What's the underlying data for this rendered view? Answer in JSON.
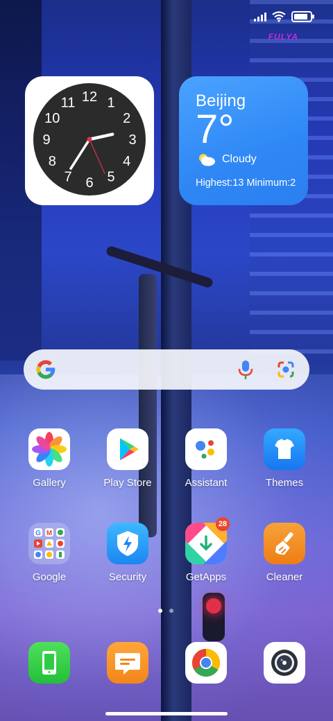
{
  "status_bar": {
    "signal": "signal-icon",
    "wifi": "wifi-icon",
    "battery_level": 0.85,
    "watermark": "FULYA"
  },
  "clock": {
    "numbers": [
      "12",
      "1",
      "2",
      "3",
      "4",
      "5",
      "6",
      "7",
      "8",
      "9",
      "10",
      "11"
    ],
    "hour": 2,
    "minute": 35,
    "second": 26
  },
  "weather": {
    "city": "Beijing",
    "temperature": "7°",
    "condition": "Cloudy",
    "high_low": "Highest:13 Minimum:2"
  },
  "search": {
    "google_icon": "google-g-icon",
    "mic_icon": "mic-icon",
    "lens_icon": "lens-icon"
  },
  "apps": [
    {
      "label": "Gallery",
      "icon": "gallery-icon"
    },
    {
      "label": "Play Store",
      "icon": "play-store-icon"
    },
    {
      "label": "Assistant",
      "icon": "assistant-icon"
    },
    {
      "label": "Themes",
      "icon": "themes-icon"
    },
    {
      "label": "Google",
      "icon": "google-folder-icon"
    },
    {
      "label": "Security",
      "icon": "security-icon"
    },
    {
      "label": "GetApps",
      "icon": "getapps-icon",
      "badge": "28"
    },
    {
      "label": "Cleaner",
      "icon": "cleaner-icon"
    }
  ],
  "dock": [
    {
      "icon": "phone-icon"
    },
    {
      "icon": "messages-icon"
    },
    {
      "icon": "chrome-icon"
    },
    {
      "icon": "camera-icon"
    }
  ],
  "page_indicator": {
    "current": 1,
    "total": 2
  }
}
